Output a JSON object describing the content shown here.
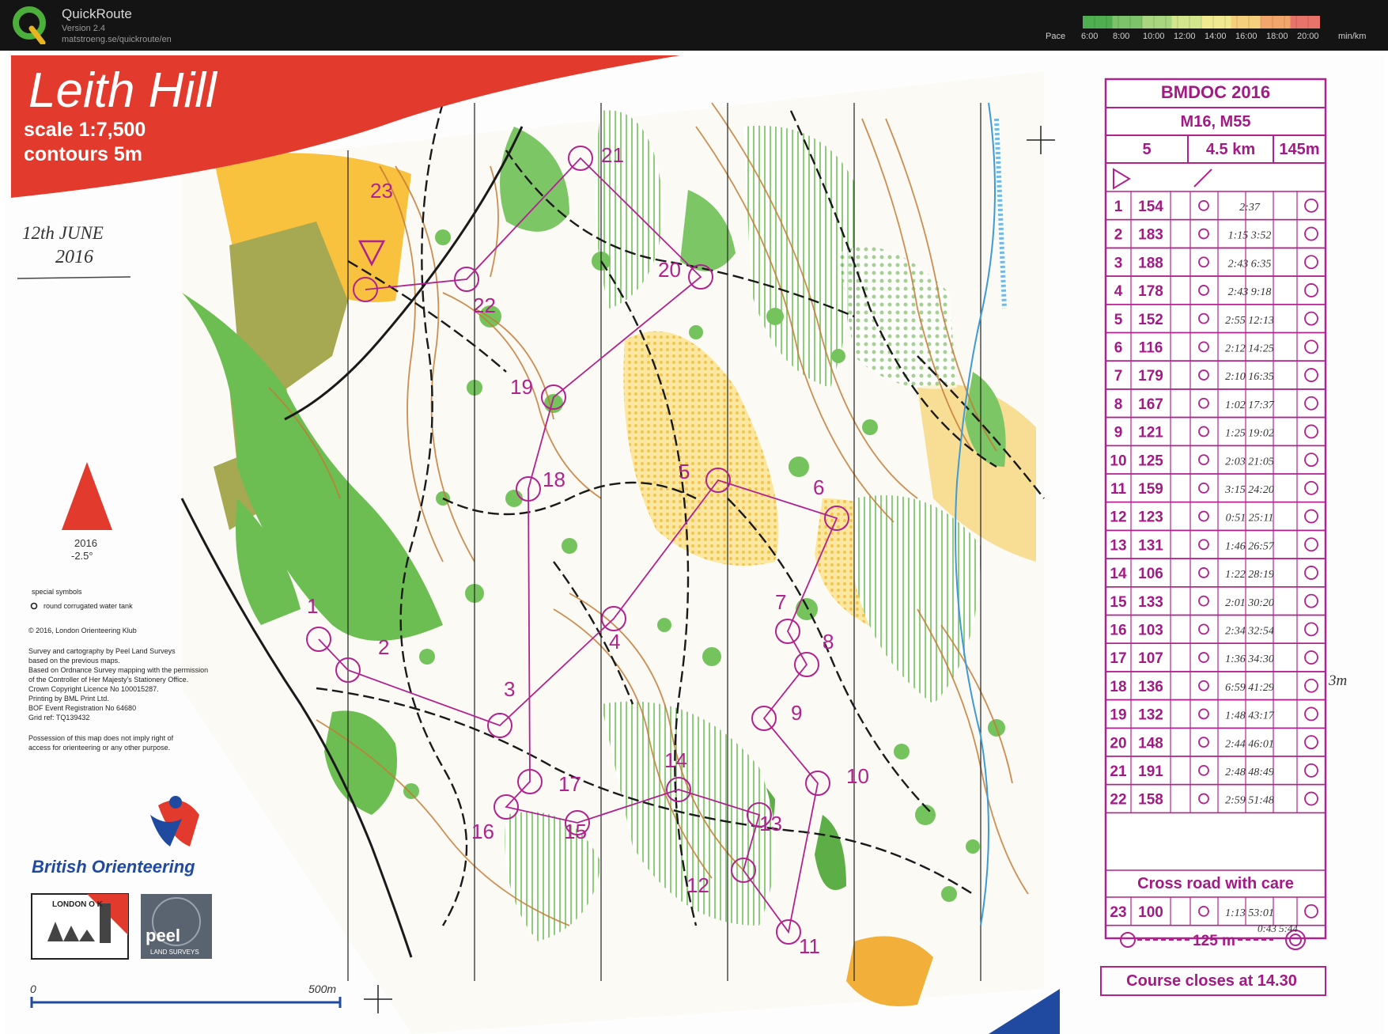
{
  "app": {
    "name": "QuickRoute",
    "version": "Version 2.4",
    "url": "matstroeng.se/quickroute/en",
    "pace_label": "Pace",
    "pace_unit": "min/km",
    "pace_ticks": [
      "6:00",
      "8:00",
      "10:00",
      "12:00",
      "14:00",
      "16:00",
      "18:00",
      "20:00"
    ],
    "pace_colors": [
      "#4fae4f",
      "#7cc36a",
      "#a9d77f",
      "#d3e68d",
      "#f0e98f",
      "#f6cf7d",
      "#f2a66b",
      "#e8736a"
    ]
  },
  "map": {
    "title": "Leith Hill",
    "scale": "scale 1:7,500",
    "contours": "contours 5m",
    "date_handwritten_line1": "12th JUNE",
    "date_handwritten_line2": "2016",
    "north_year": "2016",
    "north_declination": "-2.5°",
    "special_symbols_title": "special symbols",
    "special_symbol_1": "round corrugated water tank",
    "copyright": "© 2016, London Orienteering Klub",
    "credits": [
      "Survey and cartography by Peel Land Surveys",
      "based on the previous maps.",
      "Based on Ordnance Survey mapping with the permission",
      "of the Controller of Her Majesty's Stationery Office.",
      "Crown Copyright Licence No 100015287.",
      "Printing by BML Print Ltd.",
      "BOF Event Registration No 64680",
      "Grid ref: TQ139432"
    ],
    "possession": [
      "Possession of this map does not imply right of",
      "access for orienteering or any other purpose."
    ],
    "british_orienteering": "British Orienteering",
    "lok_logo": "LONDON O K",
    "peel_logo": "peel",
    "peel_sub": "LAND SURVEYS",
    "scale_bar_start": "0",
    "scale_bar_end": "500m",
    "side_note": "3m",
    "colors": {
      "red_banner": "#e23a2d",
      "purple": "#b0238f",
      "green": "#5cb644",
      "yellow": "#f7c845",
      "olive": "#a3a84e",
      "brown": "#c9782f"
    }
  },
  "controls": {
    "labels": [
      "1",
      "2",
      "3",
      "4",
      "5",
      "6",
      "7",
      "8",
      "9",
      "10",
      "11",
      "12",
      "13",
      "14",
      "15",
      "16",
      "17",
      "18",
      "19",
      "20",
      "21",
      "22",
      "23"
    ]
  },
  "description_sheet": {
    "event": "BMDOC 2016",
    "classes": "M16, M55",
    "controls_count": "5",
    "length": "4.5 km",
    "climb": "145m",
    "rows": [
      {
        "n": "1",
        "code": "154",
        "splits": "2:37"
      },
      {
        "n": "2",
        "code": "183",
        "splits": "1:15 3:52"
      },
      {
        "n": "3",
        "code": "188",
        "splits": "2:43 6:35"
      },
      {
        "n": "4",
        "code": "178",
        "splits": "2:43 9:18"
      },
      {
        "n": "5",
        "code": "152",
        "splits": "2:55 12:13"
      },
      {
        "n": "6",
        "code": "116",
        "splits": "2:12 14:25"
      },
      {
        "n": "7",
        "code": "179",
        "splits": "2:10 16:35"
      },
      {
        "n": "8",
        "code": "167",
        "splits": "1:02 17:37"
      },
      {
        "n": "9",
        "code": "121",
        "splits": "1:25 19:02"
      },
      {
        "n": "10",
        "code": "125",
        "splits": "2:03 21:05"
      },
      {
        "n": "11",
        "code": "159",
        "splits": "3:15 24:20"
      },
      {
        "n": "12",
        "code": "123",
        "splits": "0:51 25:11"
      },
      {
        "n": "13",
        "code": "131",
        "splits": "1:46 26:57"
      },
      {
        "n": "14",
        "code": "106",
        "splits": "1:22 28:19"
      },
      {
        "n": "15",
        "code": "133",
        "splits": "2:01 30:20"
      },
      {
        "n": "16",
        "code": "103",
        "splits": "2:34 32:54"
      },
      {
        "n": "17",
        "code": "107",
        "splits": "1:36 34:30"
      },
      {
        "n": "18",
        "code": "136",
        "splits": "6:59 41:29"
      },
      {
        "n": "19",
        "code": "132",
        "splits": "1:48 43:17"
      },
      {
        "n": "20",
        "code": "148",
        "splits": "2:44 46:01"
      },
      {
        "n": "21",
        "code": "191",
        "splits": "2:48 48:49"
      },
      {
        "n": "22",
        "code": "158",
        "splits": "2:59 51:48"
      }
    ],
    "cross_road": "Cross road with care",
    "row23": {
      "n": "23",
      "code": "100",
      "splits": "1:13 53:01"
    },
    "finish_distance": "125 m",
    "finish_split": "0:43 5:44",
    "closes": "Course closes at 14.30"
  }
}
